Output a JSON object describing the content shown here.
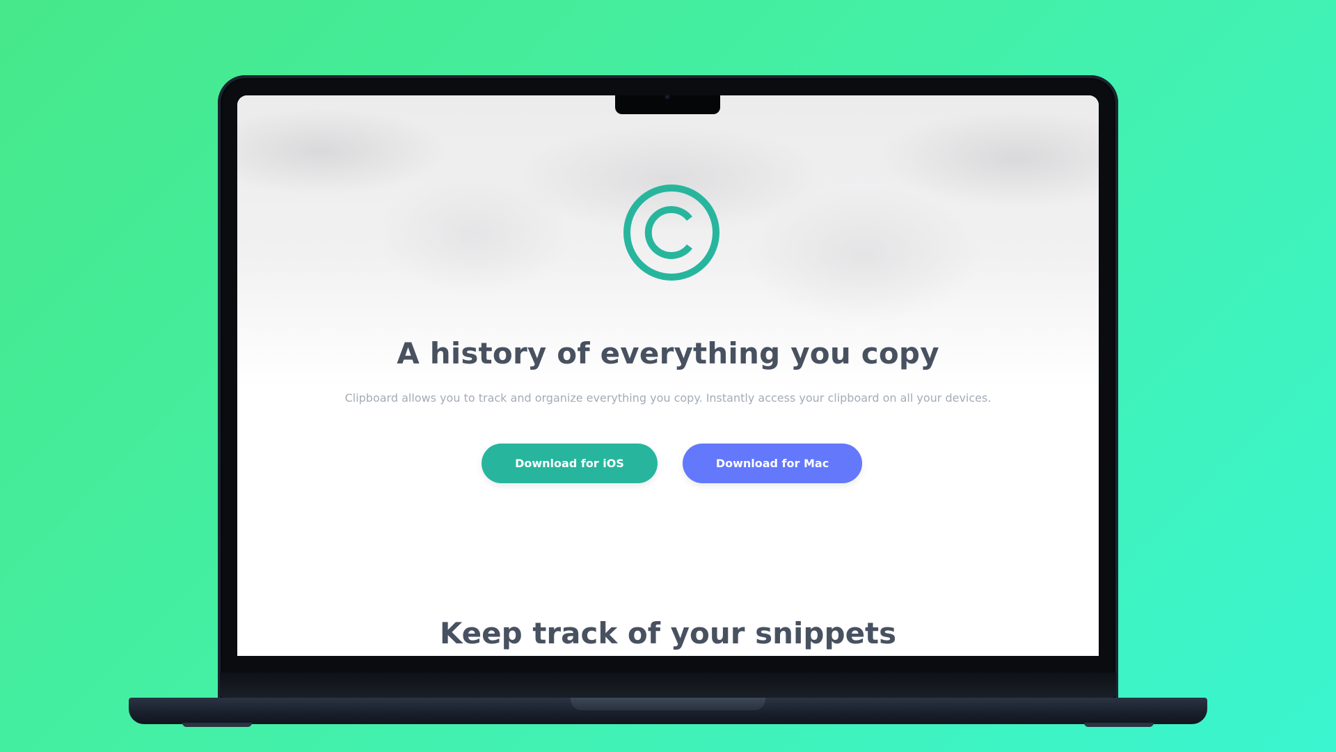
{
  "page": {
    "hero_title": "A history of everything you copy",
    "hero_subtitle": "Clipboard allows you to track and organize everything you copy. Instantly access your clipboard on all your devices.",
    "next_section_title": "Keep track of your snippets"
  },
  "buttons": {
    "ios_label": "Download for iOS",
    "mac_label": "Download for Mac"
  },
  "icons": {
    "logo": "copyright-logo-icon"
  },
  "colors": {
    "brand_teal": "#27b69d",
    "button_mac": "#6378fb",
    "heading_text": "#485160",
    "body_text": "#a3abb6",
    "background_gradient_start": "#46e88a",
    "background_gradient_end": "#3af5d0"
  }
}
